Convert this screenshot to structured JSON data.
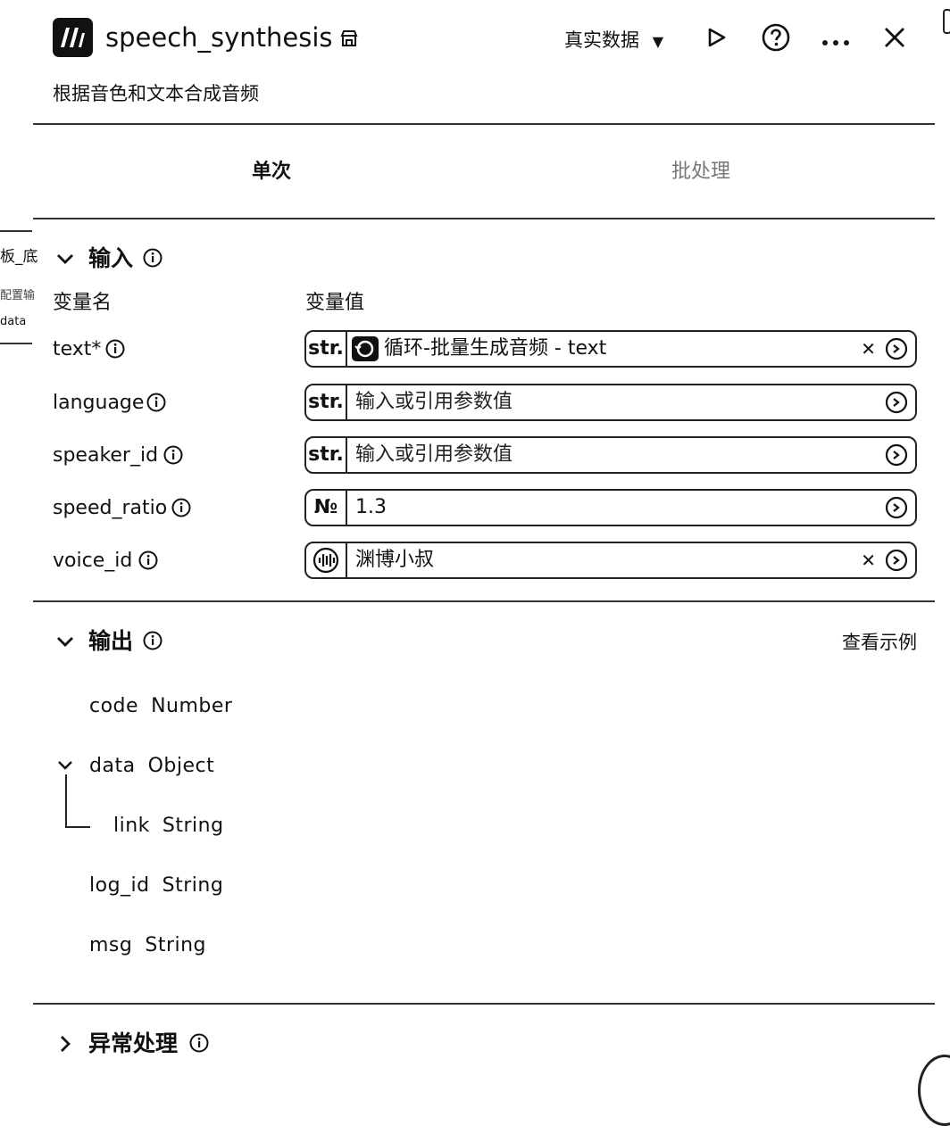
{
  "node": {
    "title": "speech_synthesis",
    "description": "根据音色和文本合成音频",
    "data_mode": "真实数据"
  },
  "tabs": {
    "single": "单次",
    "batch": "批处理"
  },
  "input": {
    "title": "输入",
    "col_name": "变量名",
    "col_value": "变量值",
    "rows": [
      {
        "name": "text*",
        "type_tag": "str.",
        "value": "循环-批量生成音频 - text",
        "has_clear": true,
        "icon": "loop-node-icon"
      },
      {
        "name": "language",
        "type_tag": "str.",
        "placeholder": "输入或引用参数值"
      },
      {
        "name": "speaker_id",
        "type_tag": "str.",
        "placeholder": "输入或引用参数值"
      },
      {
        "name": "speed_ratio",
        "type_tag": "№",
        "value": "1.3"
      },
      {
        "name": "voice_id",
        "type_tag": "",
        "value": "渊博小叔",
        "has_clear": true,
        "icon": "voice-waveform-icon"
      }
    ]
  },
  "output": {
    "title": "输出",
    "view_example": "查看示例",
    "fields": [
      {
        "name": "code",
        "type": "Number"
      },
      {
        "name": "data",
        "type": "Object"
      },
      {
        "name": "link",
        "type": "String"
      },
      {
        "name": "log_id",
        "type": "String"
      },
      {
        "name": "msg",
        "type": "String"
      }
    ]
  },
  "exception": {
    "title": "异常处理"
  },
  "background": {
    "left_texts": [
      "板_底",
      "配置输",
      "data"
    ]
  }
}
